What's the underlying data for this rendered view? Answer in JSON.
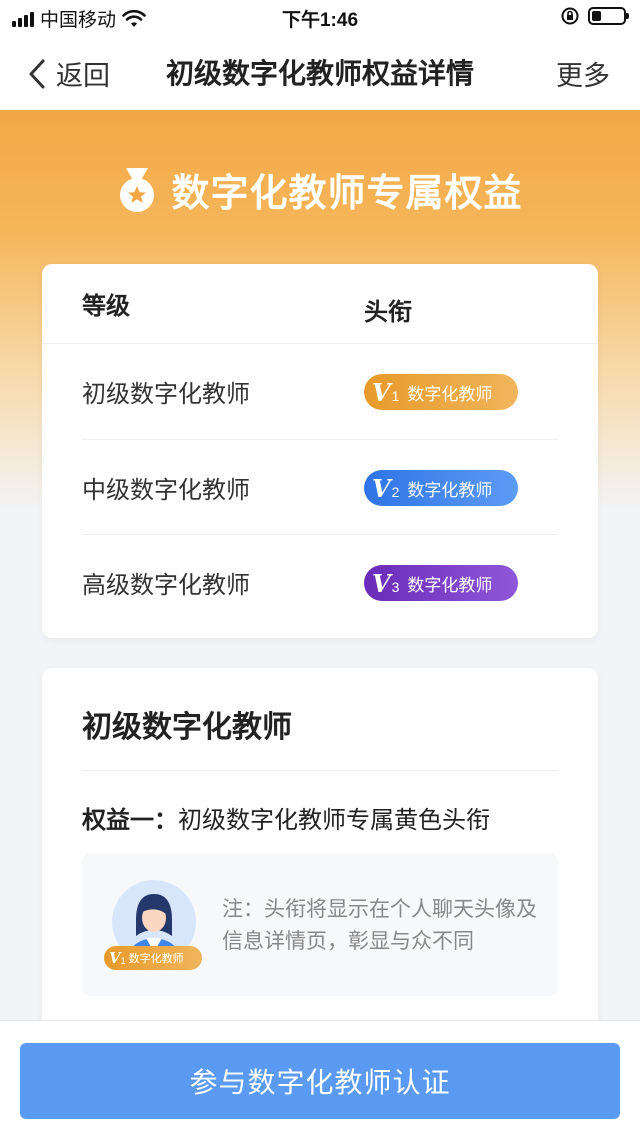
{
  "status_bar": {
    "carrier": "中国移动",
    "time": "下午1:46"
  },
  "nav": {
    "back_label": "返回",
    "title": "初级数字化教师权益详情",
    "more_label": "更多"
  },
  "hero": {
    "title": "数字化教师专属权益"
  },
  "level_table": {
    "headers": [
      "等级",
      "头衔"
    ],
    "rows": [
      {
        "level": "初级数字化教师",
        "badge_v": "V",
        "badge_num": "1",
        "badge_text": "数字化教师",
        "color": "#e89a2a"
      },
      {
        "level": "中级数字化教师",
        "badge_v": "V",
        "badge_num": "2",
        "badge_text": "数字化教师",
        "color": "#2f74e6"
      },
      {
        "level": "高级数字化教师",
        "badge_v": "V",
        "badge_num": "3",
        "badge_text": "数字化教师",
        "color": "#6a2bb8"
      }
    ]
  },
  "detail": {
    "title": "初级数字化教师",
    "benefit_prefix": "权益一：",
    "benefit_text": "初级数字化教师专属黄色头衔",
    "note": "注：头衔将显示在个人聊天头像及信息详情页，彰显与众不同",
    "mini_badge_v": "V",
    "mini_badge_num": "1",
    "mini_badge_text": "数字化教师"
  },
  "cta": {
    "label": "参与数字化教师认证"
  },
  "colors": {
    "accent_orange": "#f2a744",
    "cta_blue": "#5a9af2"
  }
}
